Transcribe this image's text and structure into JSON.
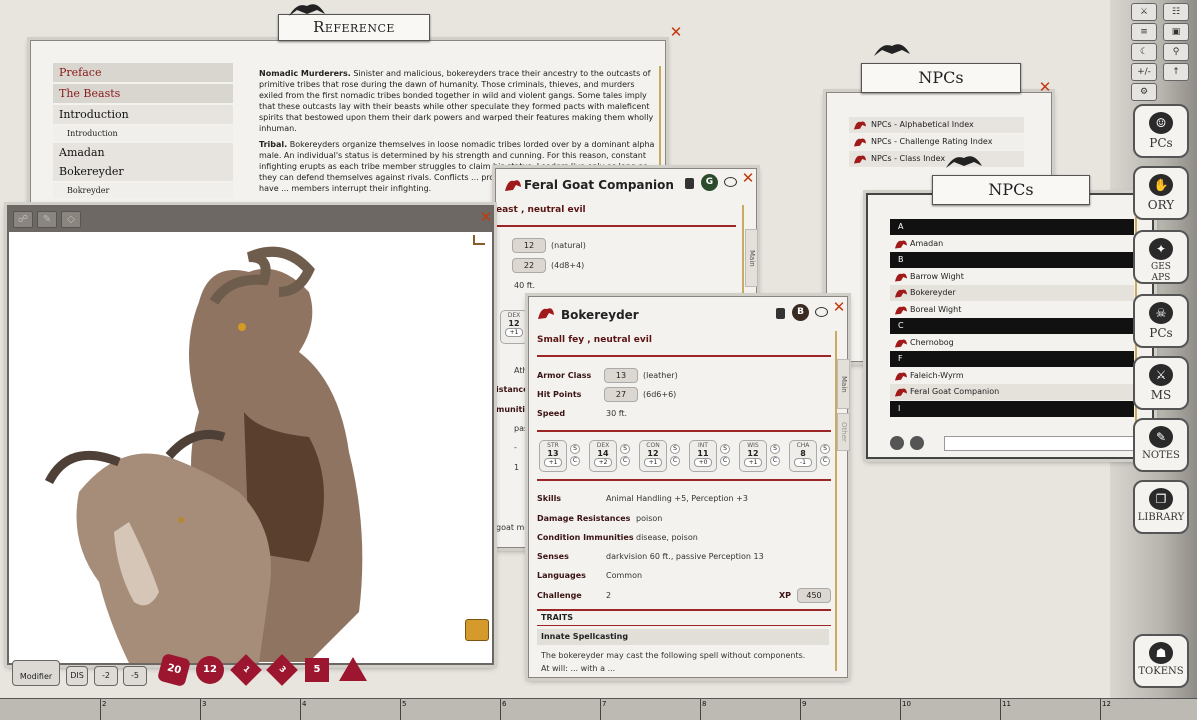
{
  "reference": {
    "title": "Reference",
    "toc": [
      "Preface",
      "The Beasts",
      "Introduction",
      "Introduction",
      "Amadan",
      "Bokereyder",
      "Bokreyder"
    ],
    "p1_bold": "Nomadic Murderers.",
    "p1": " Sinister and malicious, bokereyders trace their ancestry to the outcasts of primitive tribes that rose during the dawn of humanity. Those criminals, thieves, and murders exiled from the first nomadic tribes bonded together in wild and violent gangs. Some tales imply that these outcasts lay with their beasts while other speculate they formed pacts with maleficent spirits that bestowed upon them their dark powers and warped their features making them wholly inhuman.",
    "p2_bold": "Tribal.",
    "p2": " Bokereyders organize themselves in loose nomadic tribes lorded over by a dominant alpha male. An individual's status is determined by his strength and cunning. For this reason, constant infighting erupts as each tribe member struggles to claim his status. Leaders live only as long as they can defend themselves against rivals. Conflicts ... proudly wearing the horns of those they have ... members interrupt their infighting."
  },
  "goat": {
    "title": "Feral Goat Companion",
    "badge": "G",
    "subtitle": "east , neutral evil",
    "ac": "12",
    "ac_note": "(natural)",
    "hp": "22",
    "hp_note": "(4d8+4)",
    "speed": "40 ft.",
    "dex_name": "DEX",
    "dex": "12",
    "dex_mod": "+1",
    "frag1": "Ath",
    "frag2": "istances",
    "frag3": "munities",
    "frag4": "pas",
    "frag5": "-",
    "frag6": "1",
    "frag7": "goat mov",
    "tab": "Main"
  },
  "boke": {
    "title": "Bokereyder",
    "badge": "B",
    "subtitle": "Small fey , neutral evil",
    "ac_label": "Armor Class",
    "ac": "13",
    "ac_note": "(leather)",
    "hp_label": "Hit Points",
    "hp": "27",
    "hp_note": "(6d6+6)",
    "speed_label": "Speed",
    "speed": "30 ft.",
    "abilities": [
      {
        "n": "STR",
        "v": "13",
        "m": "+1"
      },
      {
        "n": "DEX",
        "v": "14",
        "m": "+2"
      },
      {
        "n": "CON",
        "v": "12",
        "m": "+1"
      },
      {
        "n": "INT",
        "v": "11",
        "m": "+0"
      },
      {
        "n": "WIS",
        "v": "12",
        "m": "+1"
      },
      {
        "n": "CHA",
        "v": "8",
        "m": "-1"
      }
    ],
    "skills_label": "Skills",
    "skills": "Animal Handling +5, Perception +3",
    "dr_label": "Damage Resistances",
    "dr": "poison",
    "ci_label": "Condition Immunities",
    "ci": "disease, poison",
    "senses_label": "Senses",
    "senses": "darkvision 60 ft., passive Perception 13",
    "lang_label": "Languages",
    "lang": "Common",
    "cr_label": "Challenge",
    "cr": "2",
    "xp_label": "XP",
    "xp": "450",
    "traits": "TRAITS",
    "trait1": "Innate Spellcasting",
    "trait1_text": "The bokereyder may cast the following spell without components.",
    "trait1_more": "At will: ... with a ... ",
    "tab_main": "Main",
    "tab_other": "Other"
  },
  "npc1": {
    "title": "NPCs",
    "items": [
      "NPCs - Alphabetical Index",
      "NPCs - Challenge Rating Index",
      "NPCs - Class Index"
    ]
  },
  "npc2": {
    "title": "NPCs",
    "rows": [
      {
        "t": "A",
        "sec": true
      },
      {
        "t": "Amadan"
      },
      {
        "t": "B",
        "sec": true
      },
      {
        "t": "Barrow Wight"
      },
      {
        "t": "Bokereyder"
      },
      {
        "t": "Boreal Wight"
      },
      {
        "t": "C",
        "sec": true
      },
      {
        "t": "Chernobog"
      },
      {
        "t": "F",
        "sec": true
      },
      {
        "t": "Faleich-Wyrm"
      },
      {
        "t": "Feral Goat Companion"
      },
      {
        "t": "I",
        "sec": true
      }
    ]
  },
  "sidebar": {
    "pcs": "PCs",
    "story": "ORY",
    "images": "GES",
    "maps": "APS",
    "npcs": "PCs",
    "items": "MS",
    "notes": "NOTES",
    "library": "LIBRARY",
    "tokens": "TOKENS",
    "tools": [
      "⚔",
      "☷",
      "≡",
      "▣",
      "☾",
      "⚲",
      "+/-",
      "↑",
      "⚙"
    ]
  },
  "dicebar": {
    "modifier": "Modifier",
    "mods": [
      "DIS",
      "-2",
      "-5"
    ],
    "dice": [
      "20",
      "12",
      "1",
      "3",
      "5",
      ""
    ]
  },
  "ruler": [
    "2",
    "3",
    "4",
    "5",
    "6",
    "7",
    "8",
    "9",
    "10",
    "11",
    "12"
  ]
}
